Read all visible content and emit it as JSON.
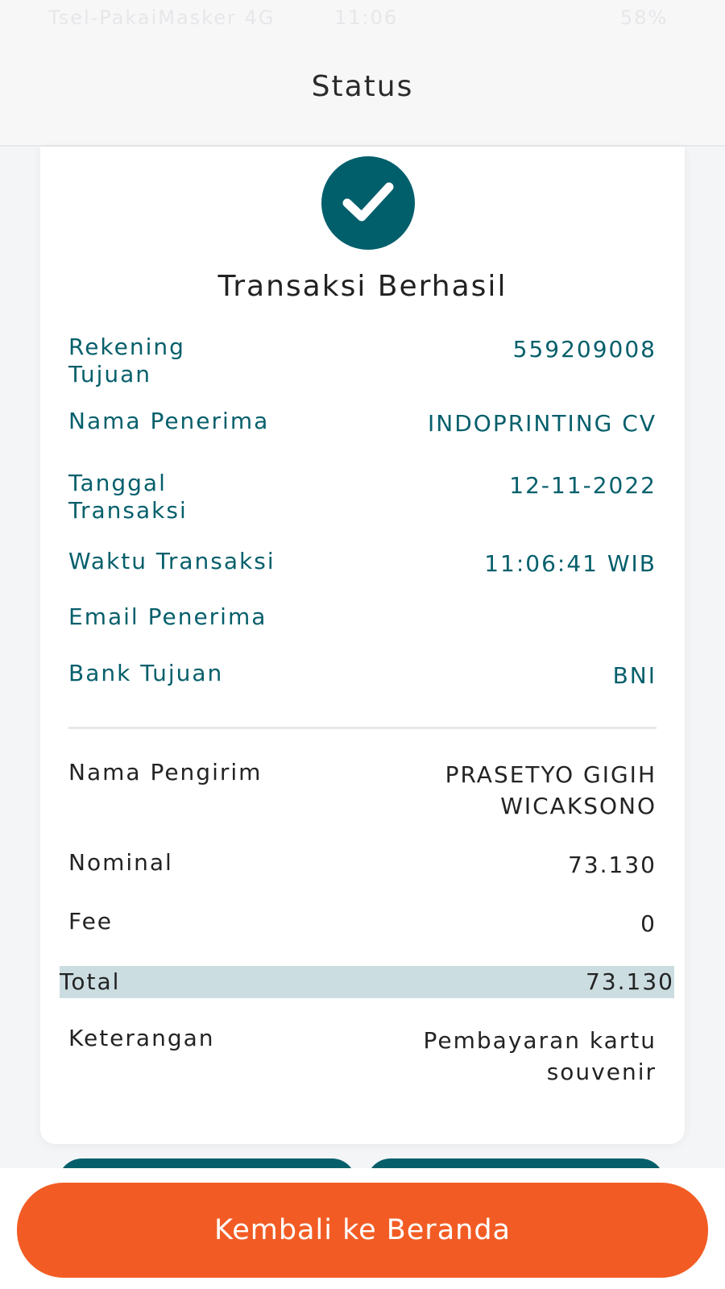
{
  "status_bar": {
    "carrier": "Tsel-PakaiMasker 4G",
    "time": "11:06",
    "battery": "58%"
  },
  "header": {
    "title": "Status"
  },
  "result": {
    "title": "Transaksi Berhasil",
    "icon": "check-icon"
  },
  "details": {
    "rekening_tujuan": {
      "label": "Rekening Tujuan",
      "value": "559209008"
    },
    "nama_penerima": {
      "label": "Nama Penerima",
      "value": "INDOPRINTING CV"
    },
    "tanggal_transaksi": {
      "label": "Tanggal Transaksi",
      "value": "12-11-2022"
    },
    "waktu_transaksi": {
      "label": "Waktu Transaksi",
      "value": "11:06:41 WIB"
    },
    "email_penerima": {
      "label": "Email Penerima",
      "value": ""
    },
    "bank_tujuan": {
      "label": "Bank Tujuan",
      "value": "BNI"
    }
  },
  "summary": {
    "nama_pengirim": {
      "label": "Nama Pengirim",
      "value": "PRASETYO GIGIH WICAKSONO"
    },
    "nominal": {
      "label": "Nominal",
      "value": "73.130"
    },
    "fee": {
      "label": "Fee",
      "value": "0"
    },
    "total": {
      "label": "Total",
      "value": "73.130"
    },
    "keterangan": {
      "label": "Keterangan",
      "value": "Pembayaran kartu souvenir"
    }
  },
  "colors": {
    "accent_teal": "#055f6b",
    "button_orange": "#f25c24",
    "total_highlight": "#ccdde1"
  },
  "footer": {
    "home_button": "Kembali ke Beranda"
  }
}
